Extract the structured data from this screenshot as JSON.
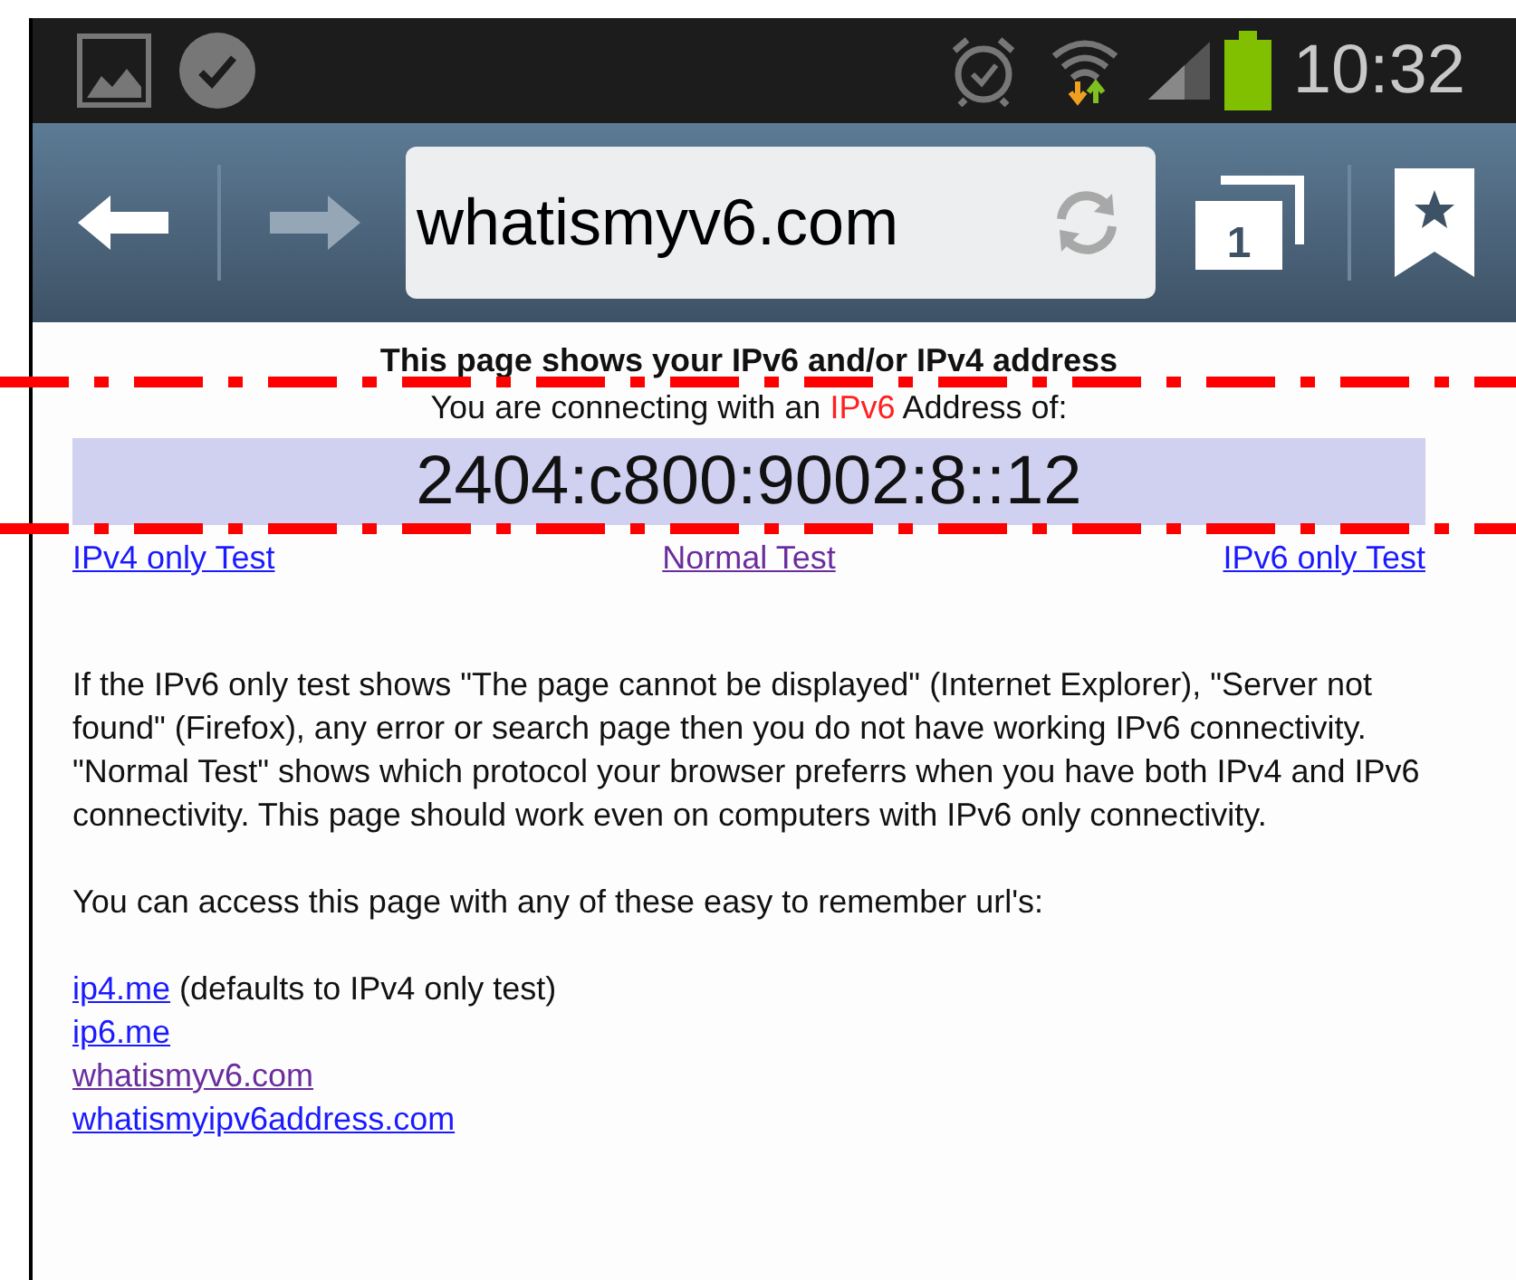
{
  "status_bar": {
    "time": "10:32"
  },
  "toolbar": {
    "url": "whatismyv6.com",
    "tab_count": "1"
  },
  "page": {
    "heading": "This page shows your IPv6 and/or IPv4 address",
    "connection": {
      "prefix": "You are connecting with an",
      "protocol": "IPv6",
      "suffix": "Address of:"
    },
    "address": "2404:c800:9002:8::12",
    "test_links": [
      {
        "label": "IPv4 only Test",
        "visited": false
      },
      {
        "label": "Normal Test",
        "visited": true
      },
      {
        "label": "IPv6 only Test",
        "visited": false
      }
    ],
    "paragraphs": [
      "If the IPv6 only test shows \"The page cannot be displayed\" (Internet Explorer), \"Server not found\" (Firefox), any error or search page then you do not have working IPv6 connectivity. \"Normal Test\" shows which protocol your browser preferrs when you have both IPv4 and IPv6 connectivity. This page should work even on computers with IPv6 only connectivity.",
      "You can access this page with any of these easy to remember url's:"
    ],
    "urls": [
      {
        "label": "ip4.me",
        "note": "(defaults to IPv4 only test)",
        "visited": false
      },
      {
        "label": "ip6.me",
        "visited": false
      },
      {
        "label": "whatismyv6.com",
        "visited": true
      },
      {
        "label": "whatismyipv6address.com",
        "visited": false
      }
    ]
  }
}
